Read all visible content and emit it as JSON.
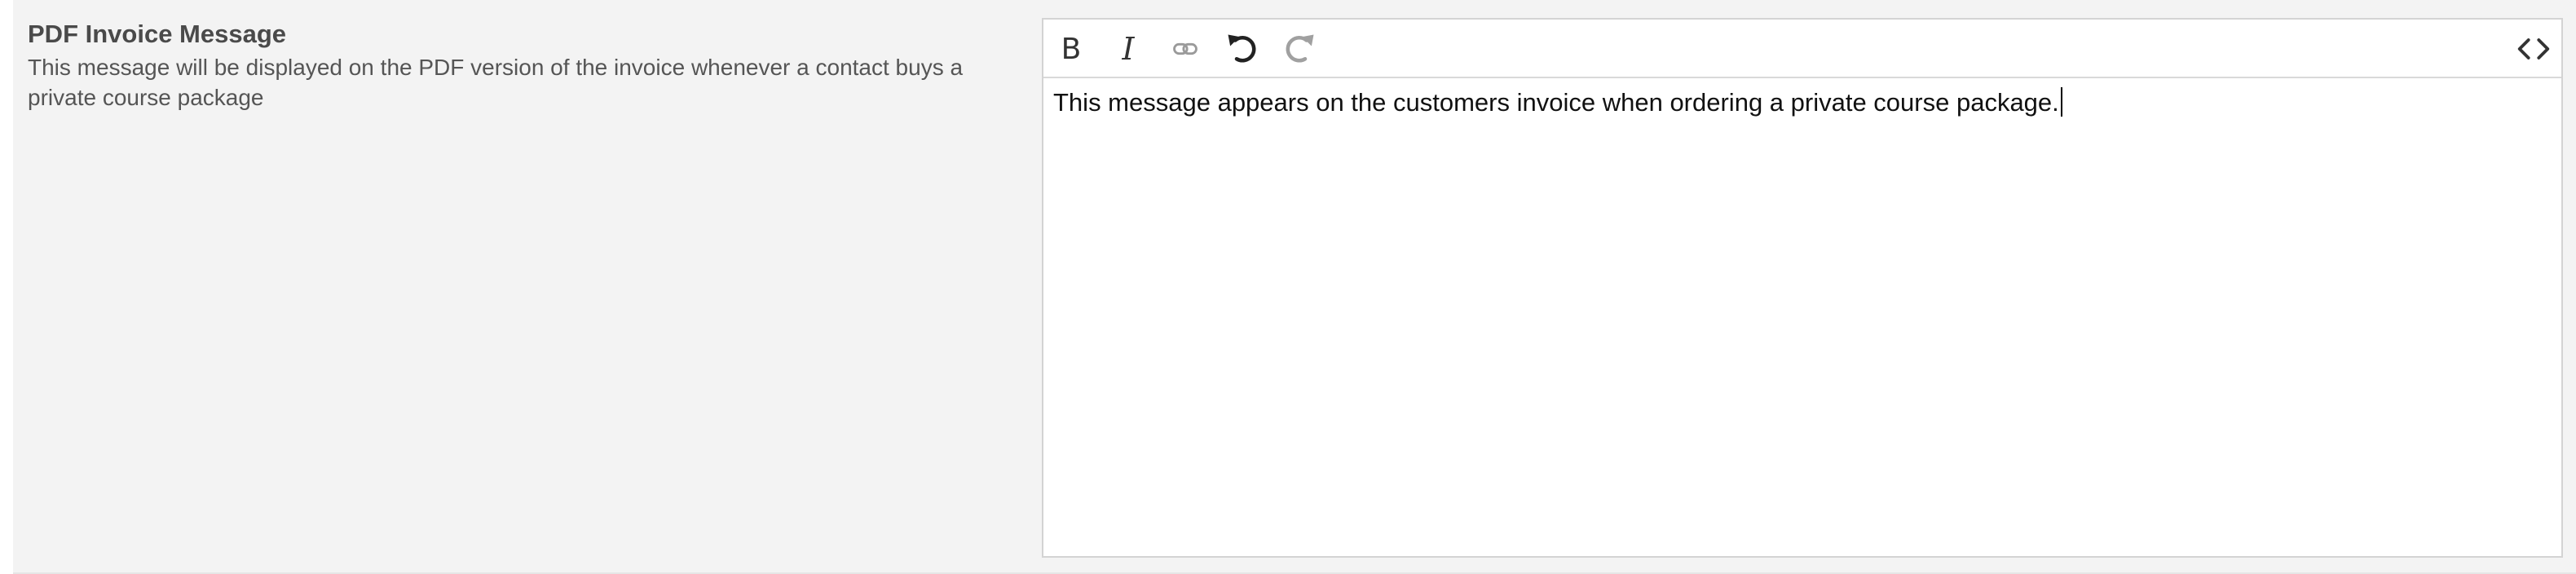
{
  "setting": {
    "title": "PDF Invoice Message",
    "description": "This message will be displayed on the PDF version of the invoice whenever a contact buys a private course package"
  },
  "editor": {
    "toolbar": {
      "bold_label": "B",
      "italic_label": "I",
      "link_icon": "link-icon",
      "undo_icon": "undo-icon",
      "redo_icon": "redo-icon",
      "source_icon": "code-icon"
    },
    "content": "This message appears on the customers invoice when ordering a private course package."
  },
  "colors": {
    "panel_bg": "#f3f3f3",
    "editor_border": "#d3d3d3",
    "title_text": "#4a4a4a",
    "disabled_icon": "#999999"
  }
}
